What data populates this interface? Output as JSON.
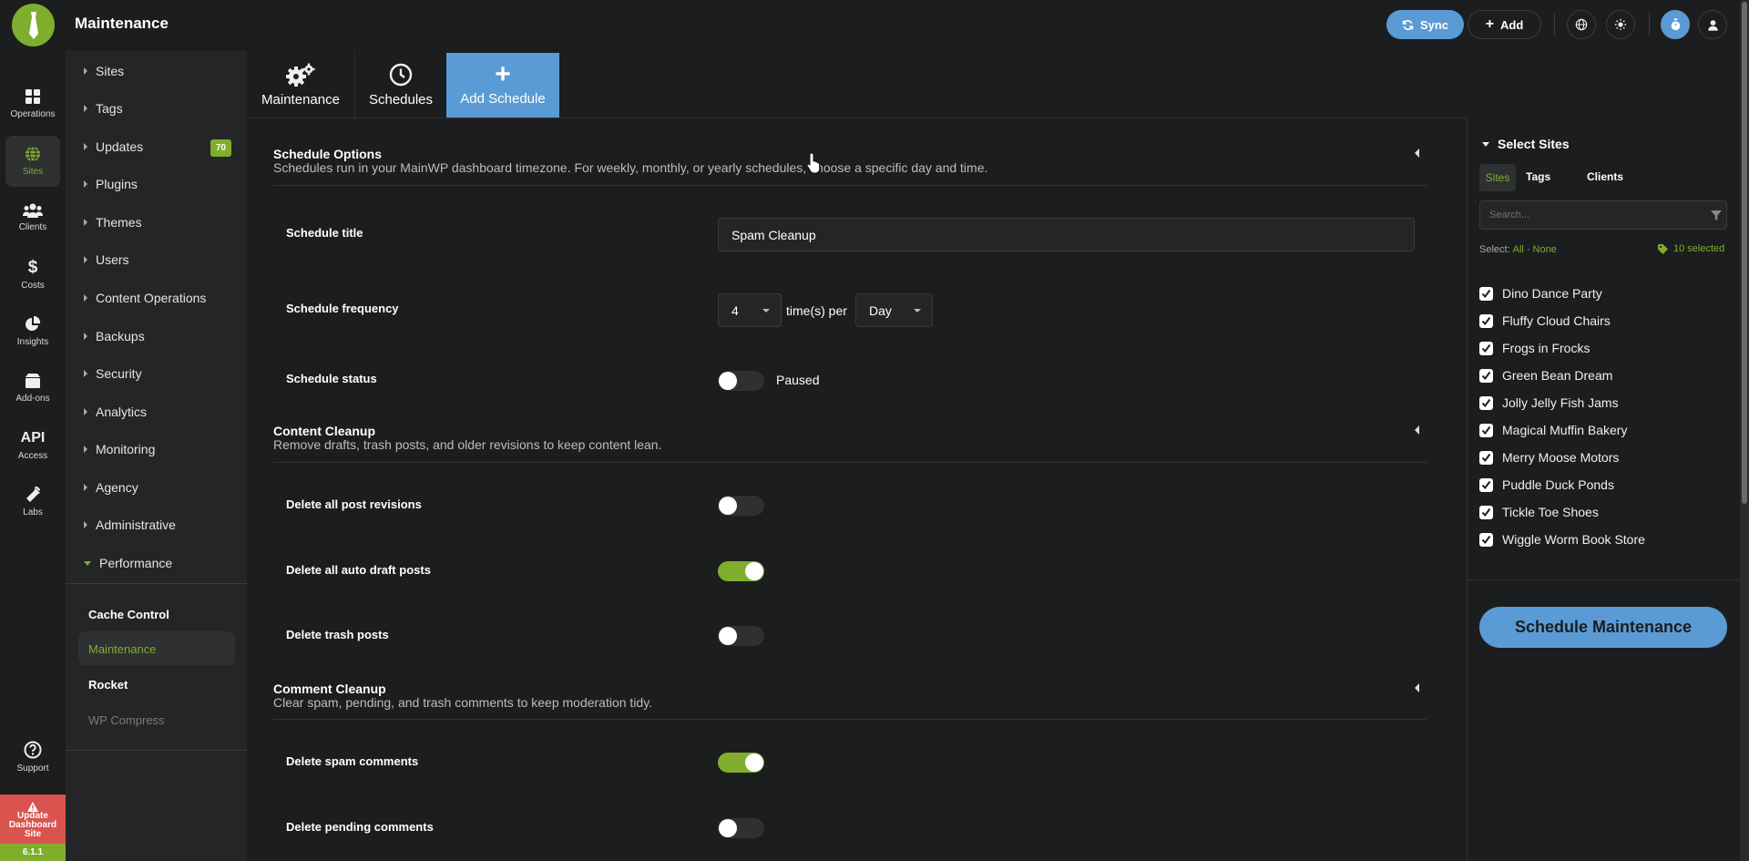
{
  "app": {
    "title": "Maintenance",
    "version": "6.1.1",
    "update_label": "Update Dashboard Site"
  },
  "topbar": {
    "sync_label": "Sync",
    "add_label": "Add"
  },
  "rail": [
    {
      "label": "Operations",
      "icon": "dashboard-icon"
    },
    {
      "label": "Sites",
      "icon": "globe-icon"
    },
    {
      "label": "Clients",
      "icon": "users-icon"
    },
    {
      "label": "Costs",
      "icon": "dollar-icon"
    },
    {
      "label": "Insights",
      "icon": "pie-chart-icon"
    },
    {
      "label": "Add-ons",
      "icon": "box-icon"
    },
    {
      "label": "Access",
      "icon_text": "API"
    },
    {
      "label": "Labs",
      "icon": "flask-icon"
    },
    {
      "label": "Support",
      "icon": "question-icon"
    }
  ],
  "nav": {
    "items": [
      "Sites",
      "Tags",
      "Updates",
      "Plugins",
      "Themes",
      "Users",
      "Content Operations",
      "Backups",
      "Security",
      "Analytics",
      "Monitoring",
      "Agency",
      "Administrative",
      "Performance"
    ],
    "updates_badge": "70",
    "sub_items": [
      "Cache Control",
      "Maintenance",
      "Rocket",
      "WP Compress"
    ]
  },
  "tabs": [
    "Maintenance",
    "Schedules",
    "Add Schedule"
  ],
  "schedule_options": {
    "title": "Schedule Options",
    "desc": "Schedules run in your MainWP dashboard timezone. For weekly, monthly, or yearly schedules, choose a specific day and time.",
    "title_label": "Schedule title",
    "title_value": "Spam Cleanup",
    "frequency_label": "Schedule frequency",
    "frequency_count": "4",
    "frequency_sep": "time(s) per",
    "frequency_unit": "Day",
    "status_label": "Schedule status",
    "status_value": "Paused"
  },
  "content_cleanup": {
    "title": "Content Cleanup",
    "desc": "Remove drafts, trash posts, and older revisions to keep content lean.",
    "rows": [
      {
        "label": "Delete all post revisions",
        "on": false
      },
      {
        "label": "Delete all auto draft posts",
        "on": true
      },
      {
        "label": "Delete trash posts",
        "on": false
      }
    ]
  },
  "comment_cleanup": {
    "title": "Comment Cleanup",
    "desc": "Clear spam, pending, and trash comments to keep moderation tidy.",
    "rows": [
      {
        "label": "Delete spam comments",
        "on": true
      },
      {
        "label": "Delete pending comments",
        "on": false
      }
    ]
  },
  "select_sites": {
    "title": "Select Sites",
    "tabs": [
      "Sites",
      "Tags",
      "Clients"
    ],
    "search_placeholder": "Search...",
    "select_label": "Select:",
    "all": "All",
    "dot": "·",
    "none": "None",
    "selected_count": "10 selected",
    "sites": [
      "Dino Dance Party",
      "Fluffy Cloud Chairs",
      "Frogs in Frocks",
      "Green Bean Dream",
      "Jolly Jelly Fish Jams",
      "Magical Muffin Bakery",
      "Merry Moose Motors",
      "Puddle Duck Ponds",
      "Tickle Toe Shoes",
      "Wiggle Worm Book Store"
    ],
    "button": "Schedule Maintenance"
  },
  "colors": {
    "accent": "#7fae2e",
    "primary": "#5b9bd5",
    "danger": "#d9534f",
    "background": "#1c1d1e"
  }
}
